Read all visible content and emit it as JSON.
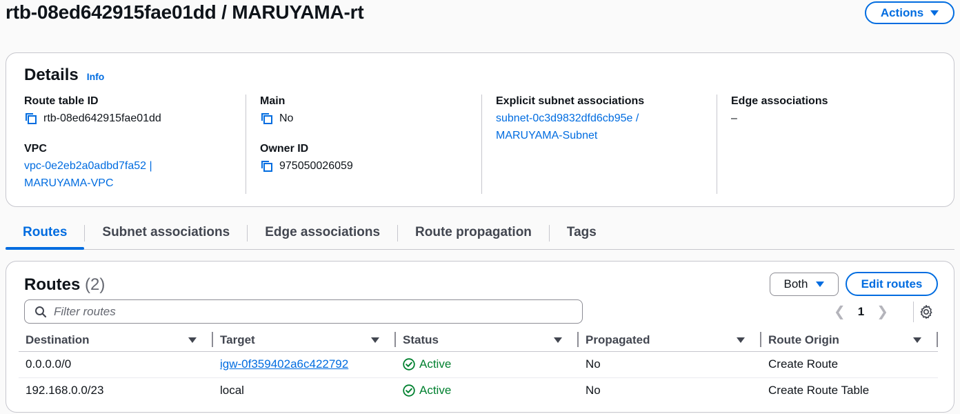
{
  "header": {
    "title": "rtb-08ed642915fae01dd / MARUYAMA-rt",
    "actions_label": "Actions"
  },
  "details": {
    "title": "Details",
    "info": "Info",
    "route_table_id_label": "Route table ID",
    "route_table_id": "rtb-08ed642915fae01dd",
    "vpc_label": "VPC",
    "vpc_line1": "vpc-0e2eb2a0adbd7fa52 |",
    "vpc_line2": "MARUYAMA-VPC",
    "main_label": "Main",
    "main_value": "No",
    "owner_label": "Owner ID",
    "owner_value": "975050026059",
    "subnet_assoc_label": "Explicit subnet associations",
    "subnet_line1": "subnet-0c3d9832dfd6cb95e /",
    "subnet_line2": "MARUYAMA-Subnet",
    "edge_label": "Edge associations",
    "edge_value": "–"
  },
  "tabs": [
    {
      "label": "Routes",
      "active": true
    },
    {
      "label": "Subnet associations"
    },
    {
      "label": "Edge associations"
    },
    {
      "label": "Route propagation"
    },
    {
      "label": "Tags"
    }
  ],
  "routes": {
    "title": "Routes",
    "count": "(2)",
    "filter_selection": "Both",
    "edit_label": "Edit routes",
    "filter_placeholder": "Filter routes",
    "page": "1",
    "columns": [
      "Destination",
      "Target",
      "Status",
      "Propagated",
      "Route Origin"
    ],
    "rows": [
      {
        "destination": "0.0.0.0/0",
        "target": "igw-0f359402a6c422792",
        "target_link": true,
        "status": "Active",
        "propagated": "No",
        "origin": "Create Route"
      },
      {
        "destination": "192.168.0.0/23",
        "target": "local",
        "target_link": false,
        "status": "Active",
        "propagated": "No",
        "origin": "Create Route Table"
      }
    ]
  },
  "colors": {
    "accent": "#006ce0",
    "success": "#00802f"
  }
}
